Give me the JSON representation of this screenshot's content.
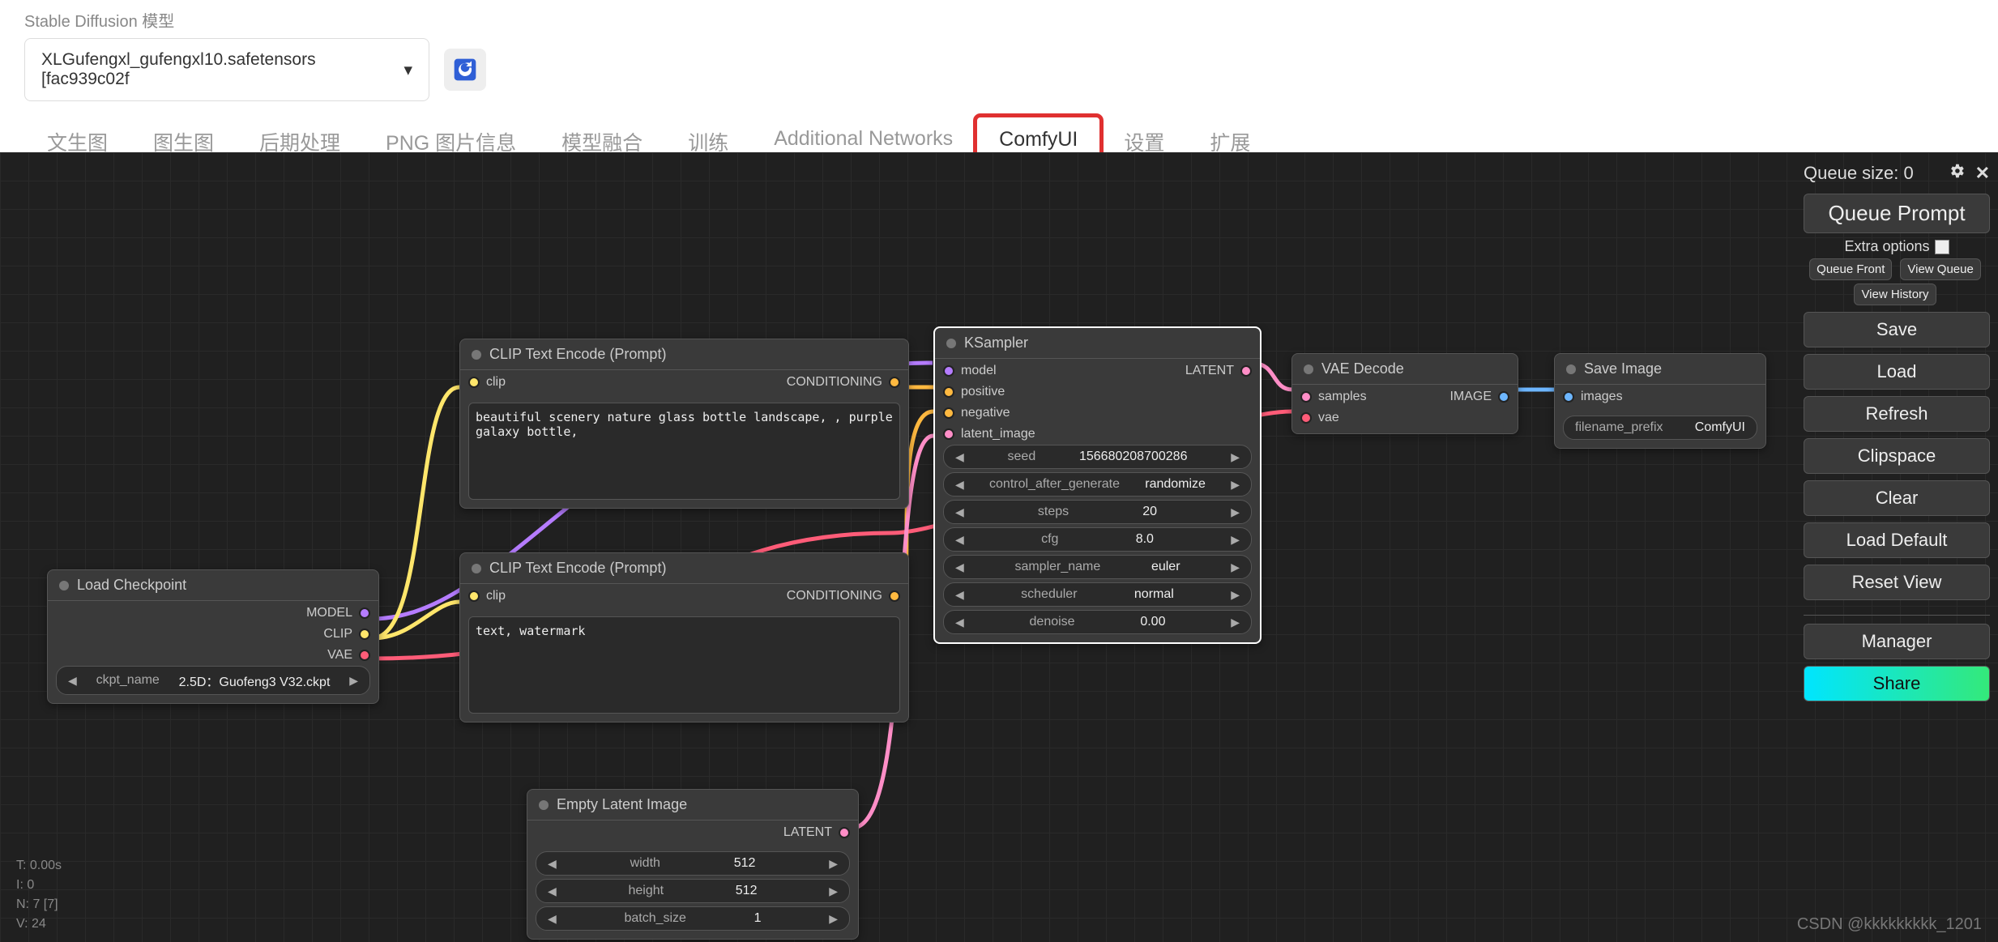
{
  "header": {
    "model_label": "Stable Diffusion 模型",
    "model_value": "XLGufengxl_gufengxl10.safetensors [fac939c02f"
  },
  "tabs": [
    "文生图",
    "图生图",
    "后期处理",
    "PNG 图片信息",
    "模型融合",
    "训练",
    "Additional Networks",
    "ComfyUI",
    "设置",
    "扩展"
  ],
  "tabs_active_index": 7,
  "tabs_highlight_index": 7,
  "panel": {
    "queue_label": "Queue size: 0",
    "queue_prompt": "Queue Prompt",
    "extra_options": "Extra options",
    "queue_front": "Queue Front",
    "view_queue": "View Queue",
    "view_history": "View History",
    "save": "Save",
    "load": "Load",
    "refresh": "Refresh",
    "clipspace": "Clipspace",
    "clear": "Clear",
    "load_default": "Load Default",
    "reset_view": "Reset View",
    "manager": "Manager",
    "share": "Share"
  },
  "nodes": {
    "load_ckpt": {
      "title": "Load Checkpoint",
      "outputs": [
        "MODEL",
        "CLIP",
        "VAE"
      ],
      "ckpt_name_label": "ckpt_name",
      "ckpt_name_value": "2.5D：Guofeng3 V32.ckpt"
    },
    "clip_pos": {
      "title": "CLIP Text Encode (Prompt)",
      "input": "clip",
      "output": "CONDITIONING",
      "text": "beautiful scenery nature glass bottle landscape, , purple galaxy bottle,"
    },
    "clip_neg": {
      "title": "CLIP Text Encode (Prompt)",
      "input": "clip",
      "output": "CONDITIONING",
      "text": "text, watermark"
    },
    "empty_latent": {
      "title": "Empty Latent Image",
      "output": "LATENT",
      "widgets": [
        {
          "name": "width",
          "value": "512"
        },
        {
          "name": "height",
          "value": "512"
        },
        {
          "name": "batch_size",
          "value": "1"
        }
      ]
    },
    "ksampler": {
      "title": "KSampler",
      "inputs": [
        "model",
        "positive",
        "negative",
        "latent_image"
      ],
      "output": "LATENT",
      "widgets": [
        {
          "name": "seed",
          "value": "156680208700286"
        },
        {
          "name": "control_after_generate",
          "value": "randomize"
        },
        {
          "name": "steps",
          "value": "20"
        },
        {
          "name": "cfg",
          "value": "8.0"
        },
        {
          "name": "sampler_name",
          "value": "euler"
        },
        {
          "name": "scheduler",
          "value": "normal"
        },
        {
          "name": "denoise",
          "value": "0.00"
        }
      ]
    },
    "vae_decode": {
      "title": "VAE Decode",
      "inputs": [
        "samples",
        "vae"
      ],
      "output": "IMAGE"
    },
    "save_image": {
      "title": "Save Image",
      "input": "images",
      "prefix_label": "filename_prefix",
      "prefix_value": "ComfyUI"
    }
  },
  "stats": "T: 0.00s\nI: 0\nN: 7 [7]\nV: 24",
  "watermark": "CSDN @kkkkkkkkk_1201"
}
